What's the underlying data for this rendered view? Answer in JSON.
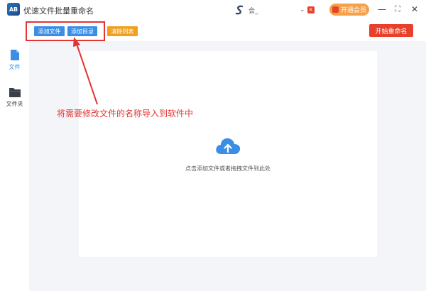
{
  "app": {
    "logo_text": "AB",
    "title": "优速文件批量重命名"
  },
  "user": {
    "name": "会_"
  },
  "header": {
    "vip_label": "开通会员",
    "minimize": "—",
    "maximize": "⛶",
    "close": "✕"
  },
  "toolbar": {
    "add_file": "添加文件",
    "add_dir": "添加目录",
    "clear_list": "清除列表",
    "start_rename": "开始重命名"
  },
  "sidebar": {
    "items": [
      {
        "label": "文件",
        "icon": "file-icon",
        "active": true
      },
      {
        "label": "文件夹",
        "icon": "folder-icon",
        "active": false
      }
    ]
  },
  "main": {
    "drop_hint": "点击添加文件或者拖拽文件到此处"
  },
  "annotation": {
    "text": "将需要修改文件的名称导入到软件中"
  },
  "colors": {
    "accent_blue": "#3a8ee6",
    "clear_orange": "#f0a020",
    "start_red": "#e8402a",
    "annotation_red": "#e53333",
    "vip_orange": "#f6a04a"
  }
}
